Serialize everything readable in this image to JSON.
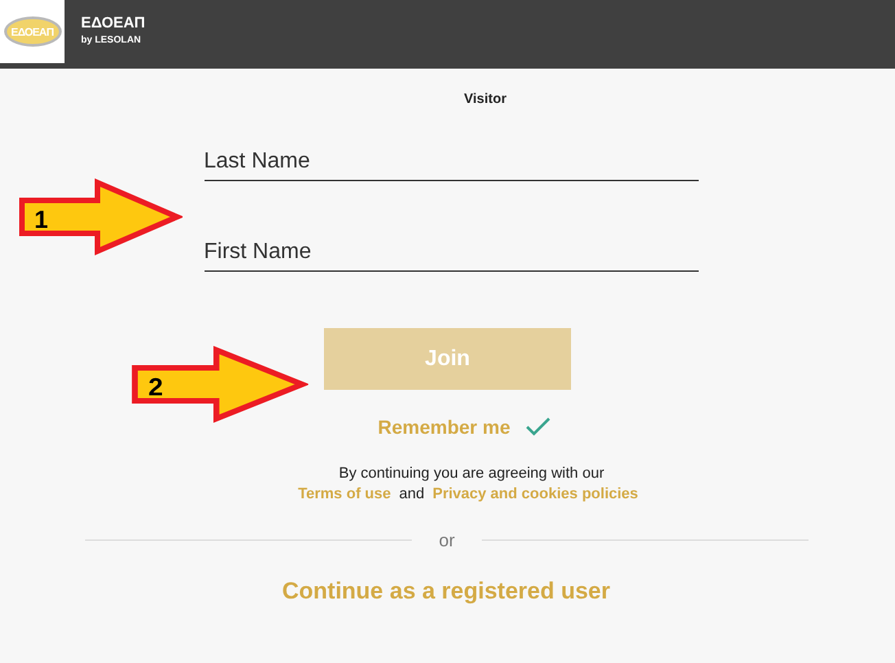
{
  "header": {
    "logo_text": "ΕΔΟΕΑΠ",
    "title": "ΕΔΟΕΑΠ",
    "subtitle": "by LESOLAN"
  },
  "form": {
    "title": "Visitor",
    "fields": [
      {
        "placeholder": "Last Name"
      },
      {
        "placeholder": "First Name"
      }
    ],
    "join_button": "Join",
    "remember": {
      "label": "Remember me",
      "checked": true
    },
    "agreement": {
      "text": "By continuing you are agreeing with our",
      "terms": "Terms of use",
      "and": "and",
      "privacy": "Privacy and cookies policies"
    },
    "separator": "or",
    "registered_link": "Continue as a registered user"
  },
  "annotations": [
    {
      "label": "1"
    },
    {
      "label": "2"
    }
  ]
}
